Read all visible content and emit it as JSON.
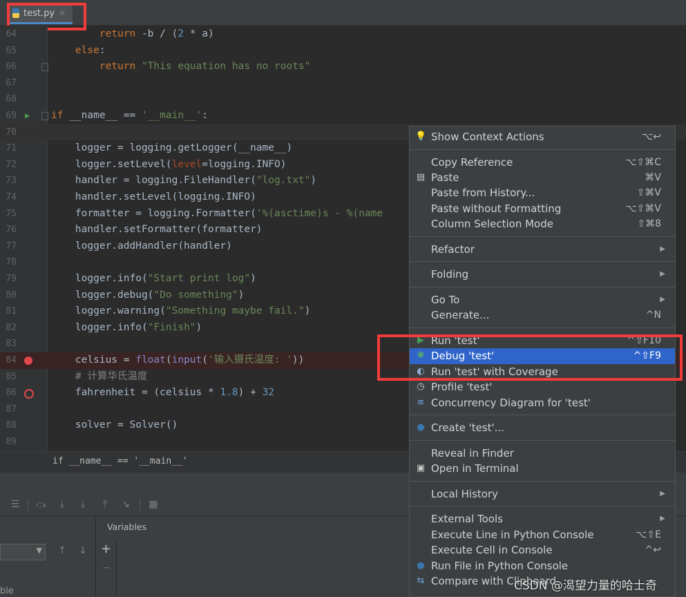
{
  "tab": {
    "filename": "test.py",
    "close_glyph": "✕"
  },
  "editor": {
    "lines": [
      {
        "n": "64",
        "segs": [
          [
            "        return ",
            "kw"
          ],
          [
            "-b / (",
            ""
          ],
          [
            "2",
            "num"
          ],
          [
            " * a)",
            ""
          ]
        ]
      },
      {
        "n": "65",
        "segs": [
          [
            "    else",
            "kw"
          ],
          [
            ":",
            ""
          ]
        ]
      },
      {
        "n": "66",
        "segs": [
          [
            "        return ",
            "kw"
          ],
          [
            "\"This equation has no roots\"",
            "str"
          ]
        ]
      },
      {
        "n": "67",
        "segs": []
      },
      {
        "n": "68",
        "segs": []
      },
      {
        "n": "69",
        "segs": [
          [
            "if ",
            "kw"
          ],
          [
            "__name__ == ",
            ""
          ],
          [
            "'__main__'",
            "str"
          ],
          [
            ":",
            ""
          ]
        ]
      },
      {
        "n": "70",
        "segs": []
      },
      {
        "n": "71",
        "segs": [
          [
            "    logger = logging.getLogger(__name__)",
            ""
          ]
        ]
      },
      {
        "n": "72",
        "segs": [
          [
            "    logger.setLevel(",
            ""
          ],
          [
            "level",
            "param"
          ],
          [
            "=logging.INFO)",
            ""
          ]
        ]
      },
      {
        "n": "73",
        "segs": [
          [
            "    handler = logging.FileHandler(",
            ""
          ],
          [
            "\"log.txt\"",
            "str"
          ],
          [
            ")",
            ""
          ]
        ]
      },
      {
        "n": "74",
        "segs": [
          [
            "    handler.setLevel(logging.INFO)",
            ""
          ]
        ]
      },
      {
        "n": "75",
        "segs": [
          [
            "    formatter = logging.Formatter(",
            ""
          ],
          [
            "'%(asctime)s - %(name",
            "str"
          ]
        ]
      },
      {
        "n": "76",
        "segs": [
          [
            "    handler.setFormatter(formatter)",
            ""
          ]
        ]
      },
      {
        "n": "77",
        "segs": [
          [
            "    logger.addHandler(handler)",
            ""
          ]
        ]
      },
      {
        "n": "78",
        "segs": []
      },
      {
        "n": "79",
        "segs": [
          [
            "    logger.info(",
            ""
          ],
          [
            "\"Start print log\"",
            "str"
          ],
          [
            ")",
            ""
          ]
        ]
      },
      {
        "n": "80",
        "segs": [
          [
            "    logger.debug(",
            ""
          ],
          [
            "\"Do something\"",
            "str"
          ],
          [
            ")",
            ""
          ]
        ]
      },
      {
        "n": "81",
        "segs": [
          [
            "    logger.warning(",
            ""
          ],
          [
            "\"Something maybe fail.\"",
            "str"
          ],
          [
            ")",
            ""
          ]
        ]
      },
      {
        "n": "82",
        "segs": [
          [
            "    logger.info(",
            ""
          ],
          [
            "\"Finish\"",
            "str"
          ],
          [
            ")",
            ""
          ]
        ]
      },
      {
        "n": "83",
        "segs": []
      },
      {
        "n": "84",
        "segs": [
          [
            "    celsius = ",
            ""
          ],
          [
            "float",
            "builtin"
          ],
          [
            "(",
            ""
          ],
          [
            "input",
            "builtin"
          ],
          [
            "(",
            ""
          ],
          [
            "'输入摄氏温度: '",
            "str"
          ],
          [
            "))",
            ""
          ]
        ]
      },
      {
        "n": "85",
        "segs": [
          [
            "    # 计算华氏温度",
            "cm"
          ]
        ]
      },
      {
        "n": "86",
        "segs": [
          [
            "    fahrenheit = (celsius * ",
            ""
          ],
          [
            "1.8",
            "num"
          ],
          [
            ") + ",
            ""
          ],
          [
            "32",
            "num"
          ]
        ]
      },
      {
        "n": "87",
        "segs": []
      },
      {
        "n": "88",
        "segs": [
          [
            "    solver = Solver()",
            ""
          ]
        ]
      },
      {
        "n": "89",
        "segs": []
      }
    ]
  },
  "breadcrumb": "if __name__ == '__main__'",
  "debug_panel": {
    "variables_label": "Variables",
    "plus_glyph": "+",
    "minus_glyph": "−",
    "partial_text": "ble"
  },
  "context_menu": {
    "items": [
      {
        "label": "Show Context Actions",
        "shortcut": "⌥↩",
        "icon": "lightbulb-icon"
      },
      {
        "sep": true
      },
      {
        "label": "Copy Reference",
        "shortcut": "⌥⇧⌘C"
      },
      {
        "label": "Paste",
        "shortcut": "⌘V",
        "icon": "clipboard-icon"
      },
      {
        "label": "Paste from History...",
        "shortcut": "⇧⌘V"
      },
      {
        "label": "Paste without Formatting",
        "shortcut": "⌥⇧⌘V"
      },
      {
        "label": "Column Selection Mode",
        "shortcut": "⇧⌘8"
      },
      {
        "sep": true
      },
      {
        "label": "Refactor",
        "submenu": true
      },
      {
        "sep": true
      },
      {
        "label": "Folding",
        "submenu": true
      },
      {
        "sep": true
      },
      {
        "label": "Go To",
        "submenu": true
      },
      {
        "label": "Generate...",
        "shortcut": "^N"
      },
      {
        "sep": true
      },
      {
        "label": "Run 'test'",
        "shortcut": "^⇧F10",
        "icon": "run-icon"
      },
      {
        "label": "Debug 'test'",
        "shortcut": "^⇧F9",
        "icon": "debug-icon",
        "selected": true
      },
      {
        "label": "Run 'test' with Coverage",
        "icon": "coverage-icon"
      },
      {
        "label": "Profile 'test'",
        "icon": "profile-icon"
      },
      {
        "label": "Concurrency Diagram for 'test'",
        "icon": "concurrency-icon"
      },
      {
        "sep": true
      },
      {
        "label": "Create 'test'...",
        "icon": "python-icon"
      },
      {
        "sep": true
      },
      {
        "label": "Reveal in Finder"
      },
      {
        "label": "Open in Terminal",
        "icon": "terminal-icon"
      },
      {
        "sep": true
      },
      {
        "label": "Local History",
        "submenu": true
      },
      {
        "sep": true
      },
      {
        "label": "External Tools",
        "submenu": true
      },
      {
        "label": "Execute Line in Python Console",
        "shortcut": "⌥⇧E"
      },
      {
        "label": "Execute Cell in Console",
        "shortcut": "^↩"
      },
      {
        "label": "Run File in Python Console",
        "icon": "python-icon"
      },
      {
        "label": "Compare with Clipboard",
        "icon": "compare-icon"
      }
    ]
  },
  "watermark": "CSDN @渴望力量的哈士奇",
  "colors": {
    "selection": "#2f65ca",
    "highlight_box": "#f23b3b",
    "breakpoint": "#e0484b"
  }
}
